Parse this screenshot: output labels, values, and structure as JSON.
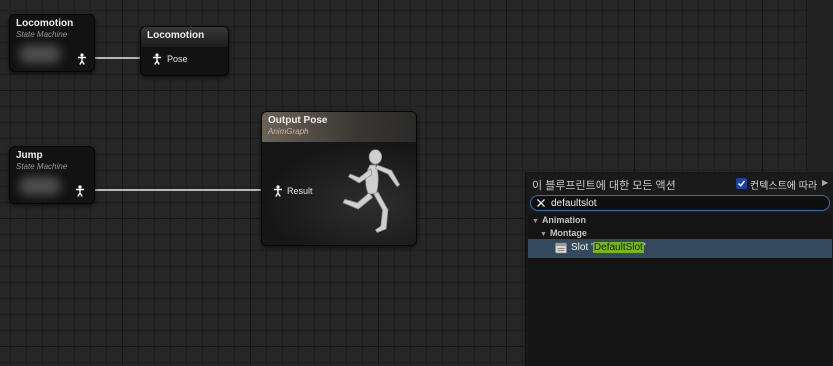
{
  "nodes": {
    "locomotion_sm": {
      "title": "Locomotion",
      "subtitle": "State Machine"
    },
    "locomotion_pose": {
      "title": "Locomotion",
      "pin": "Pose"
    },
    "output_pose": {
      "title": "Output Pose",
      "subtitle": "AnimGraph",
      "pin": "Result"
    },
    "jump_sm": {
      "title": "Jump",
      "subtitle": "State Machine"
    }
  },
  "action_menu": {
    "title": "이 블루프린트에 대한 모든 액션",
    "context_sensitive_label": "컨텍스트에 따라",
    "context_sensitive_checked": true,
    "search_value": "defaultslot",
    "categories": [
      {
        "label": "Animation"
      },
      {
        "label": "Montage"
      }
    ],
    "result": {
      "prefix": "Slot '",
      "highlight": "DefaultSlot",
      "suffix": "'"
    }
  },
  "colors": {
    "selection": "#34495e",
    "highlight": "#7ab81a",
    "search_border": "#3a6fb2"
  }
}
